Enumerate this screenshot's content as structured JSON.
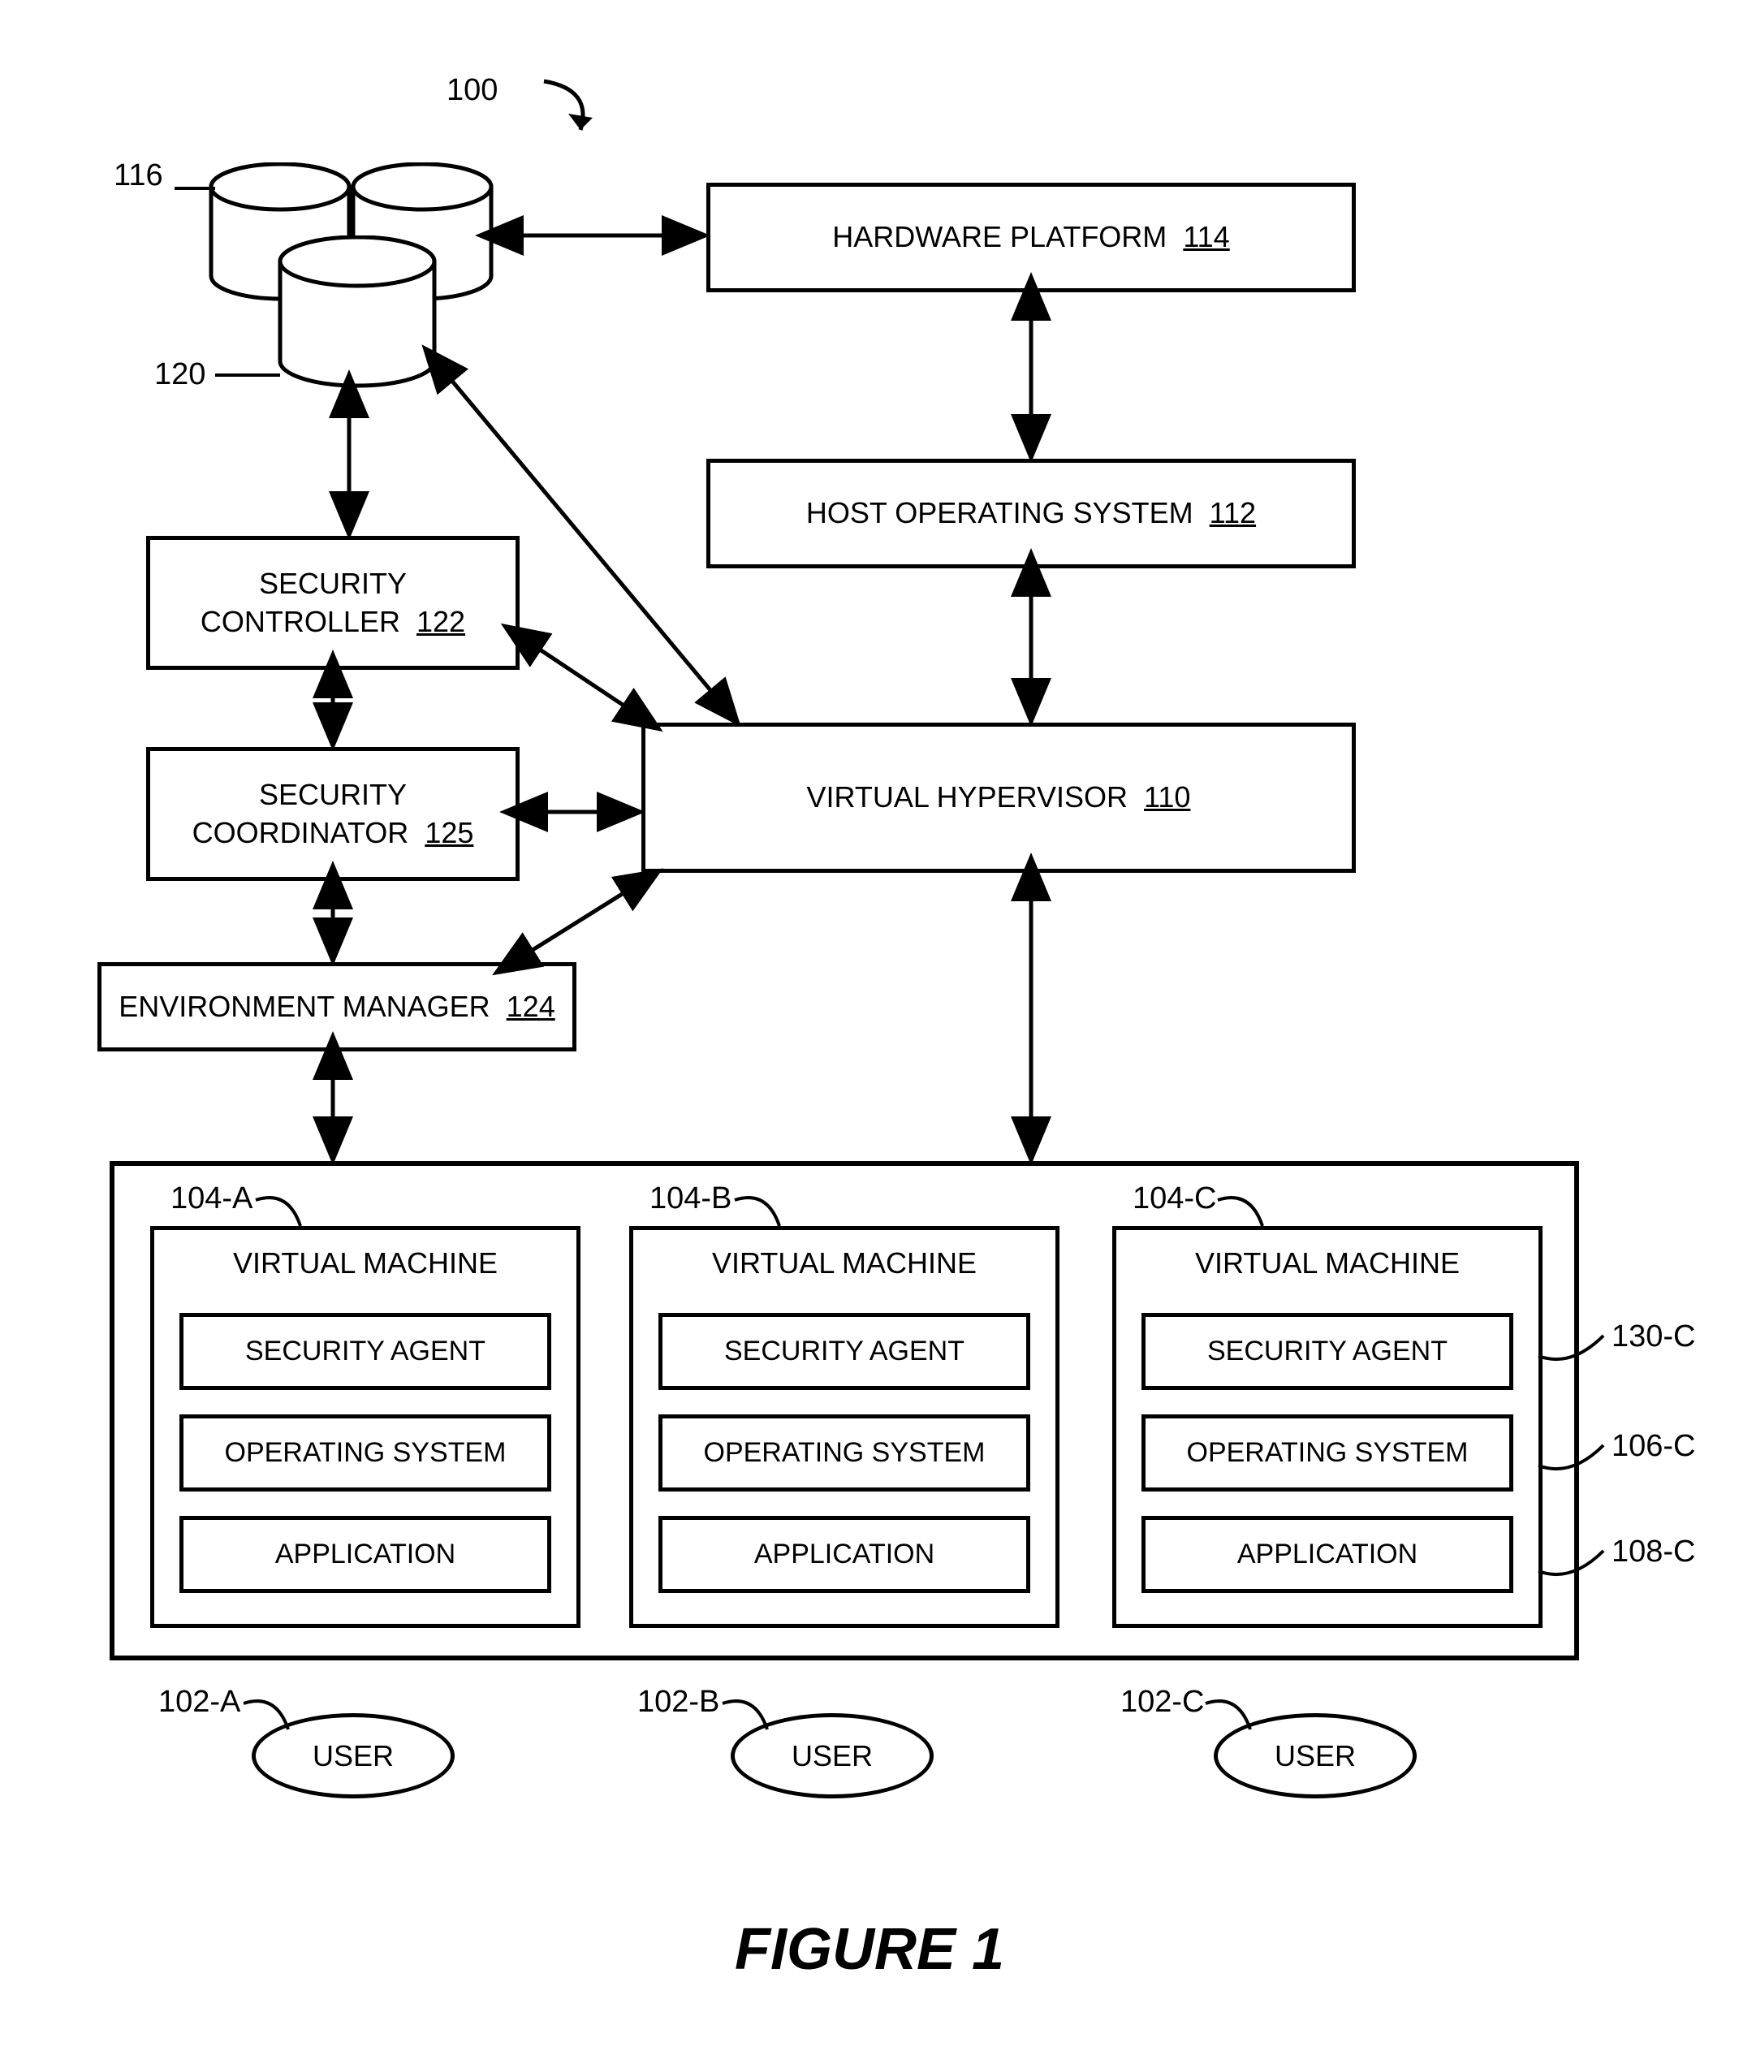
{
  "figure": {
    "id": "100",
    "caption": "FIGURE 1"
  },
  "blocks": {
    "hardware_platform": {
      "label": "HARDWARE PLATFORM",
      "ref": "114"
    },
    "host_os": {
      "label": "HOST OPERATING SYSTEM",
      "ref": "112"
    },
    "virtual_hypervisor": {
      "label": "VIRTUAL HYPERVISOR",
      "ref": "110"
    },
    "security_controller": {
      "label_l1": "SECURITY",
      "label_l2": "CONTROLLER",
      "ref": "122"
    },
    "security_coordinator": {
      "label_l1": "SECURITY",
      "label_l2": "COORDINATOR",
      "ref": "125"
    },
    "environment_manager": {
      "label": "ENVIRONMENT MANAGER",
      "ref": "124"
    }
  },
  "storage": {
    "cluster_ref": "116",
    "front_ref": "120"
  },
  "vm": {
    "title": "VIRTUAL MACHINE",
    "security_agent": "SECURITY AGENT",
    "operating_system": "OPERATING SYSTEM",
    "application": "APPLICATION",
    "refs": {
      "a": "104-A",
      "b": "104-B",
      "c": "104-C",
      "security_agent_c": "130-C",
      "operating_system_c": "106-C",
      "application_c": "108-C"
    }
  },
  "users": {
    "label": "USER",
    "refs": {
      "a": "102-A",
      "b": "102-B",
      "c": "102-C"
    }
  }
}
